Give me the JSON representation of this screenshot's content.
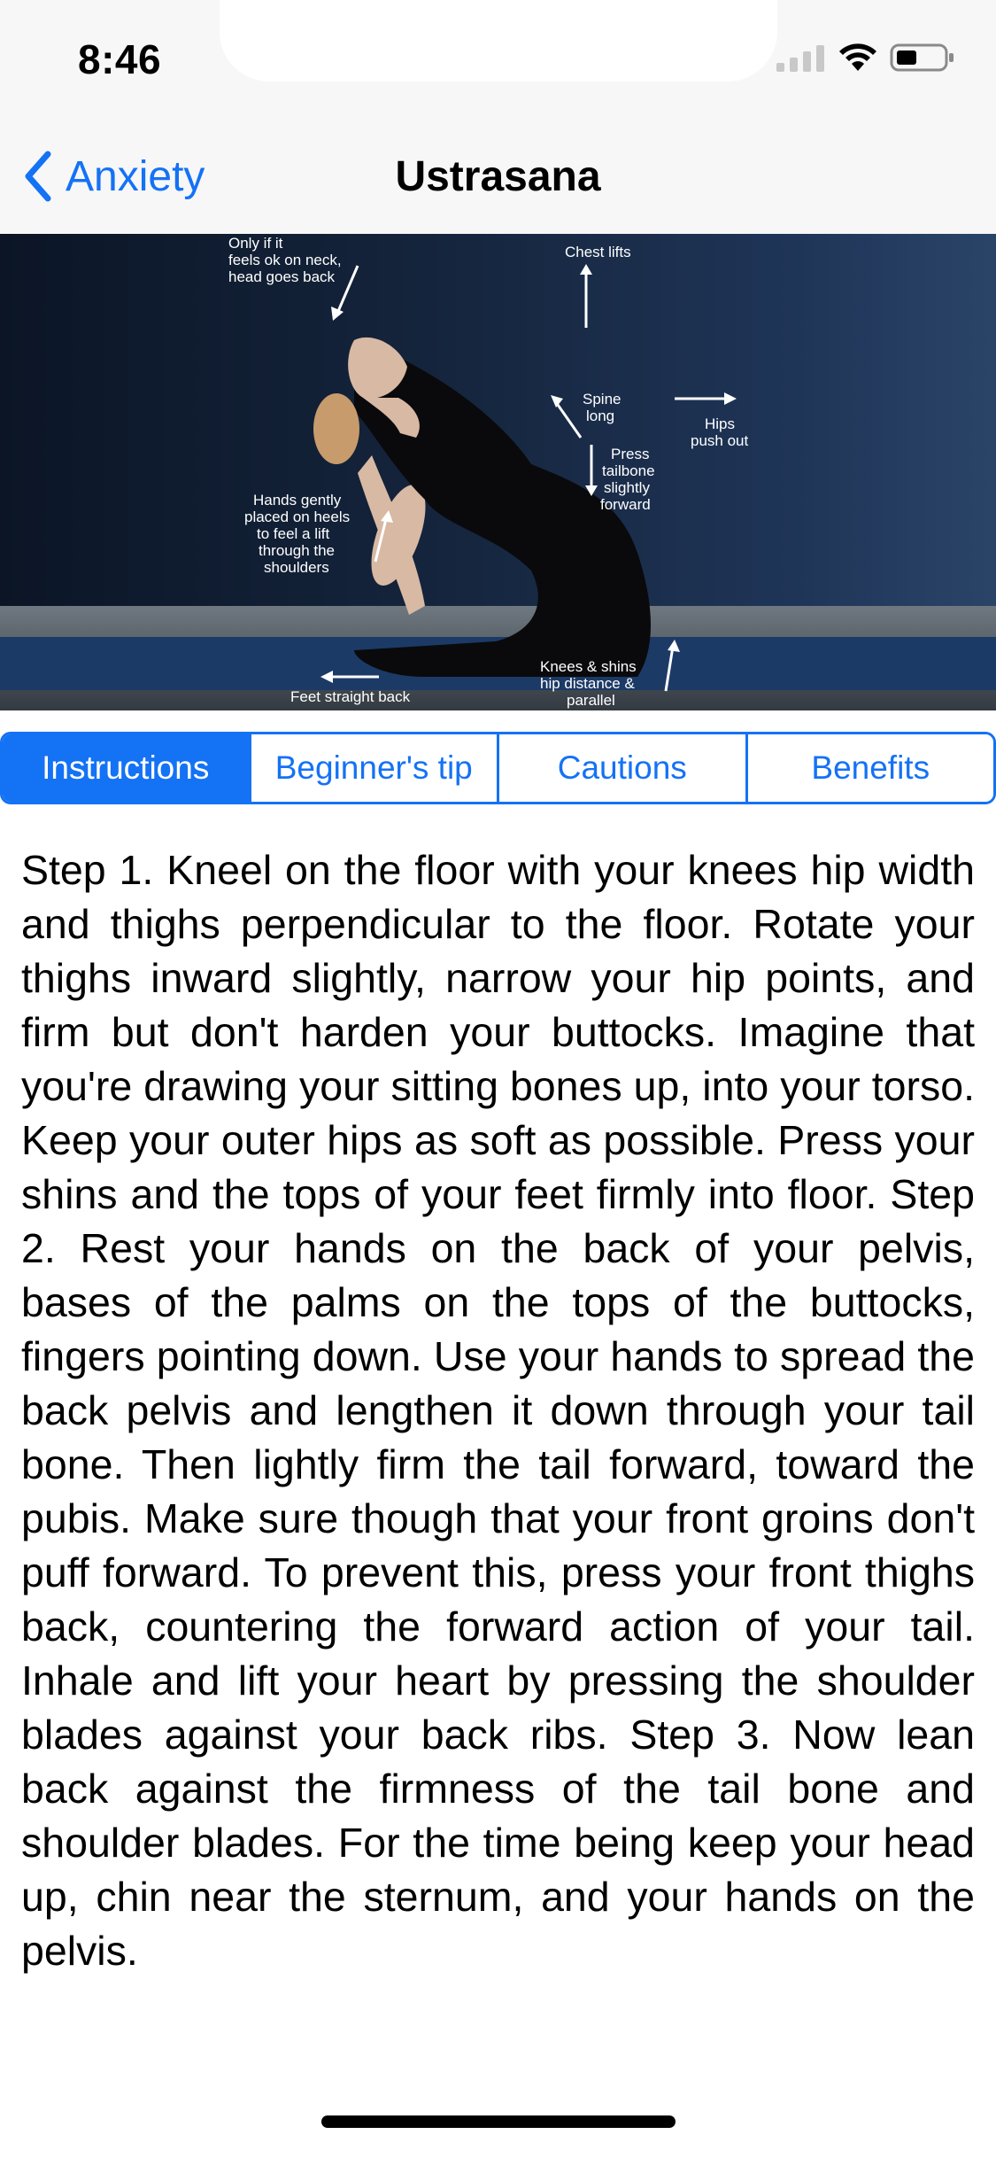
{
  "status": {
    "time": "8:46"
  },
  "nav": {
    "back_label": "Anxiety",
    "title": "Ustrasana"
  },
  "image": {
    "annotations": {
      "neck": [
        "Only if it",
        "feels ok on neck,",
        "head goes back"
      ],
      "chest": [
        "Chest lifts"
      ],
      "spine": [
        "Spine",
        "long"
      ],
      "hips": [
        "Hips",
        "push out"
      ],
      "tailbone": [
        "Press",
        "tailbone",
        "slightly",
        "forward"
      ],
      "hands": [
        "Hands gently",
        "placed on heels",
        "to feel a lift",
        "through the",
        "shoulders"
      ],
      "knees": [
        "Knees & shins",
        "hip distance &",
        "parallel"
      ],
      "feet": [
        "Feet straight back"
      ]
    }
  },
  "tabs": [
    {
      "label": "Instructions",
      "active": true
    },
    {
      "label": "Beginner's tip",
      "active": false
    },
    {
      "label": "Cautions",
      "active": false
    },
    {
      "label": "Benefits",
      "active": false
    }
  ],
  "content": {
    "text": "Step 1. Kneel on the floor with your knees hip width and thighs perpendicular to the floor. Rotate your thighs inward slightly, narrow your hip points, and firm but don't harden your buttocks. Imagine that you're drawing your sitting bones up, into your torso. Keep your outer hips as soft as possible. Press your shins and the tops of your feet firmly into floor. Step 2. Rest your hands on the back of your pelvis, bases of the palms on the tops of the buttocks, fingers pointing down. Use your hands to spread the back pelvis and lengthen it down through your tail bone. Then lightly firm the tail forward, toward the pubis. Make sure though that your front groins don't puff forward. To prevent this, press your front thighs back, countering the forward action of your tail. Inhale and lift your heart by pressing the shoulder blades against your back ribs. Step 3. Now lean back against the firmness of the tail bone and shoulder blades. For the time being keep your head up, chin near the sternum, and your hands on the pelvis."
  },
  "colors": {
    "accent": "#1472f5",
    "bar_background": "#f7f7f7"
  }
}
